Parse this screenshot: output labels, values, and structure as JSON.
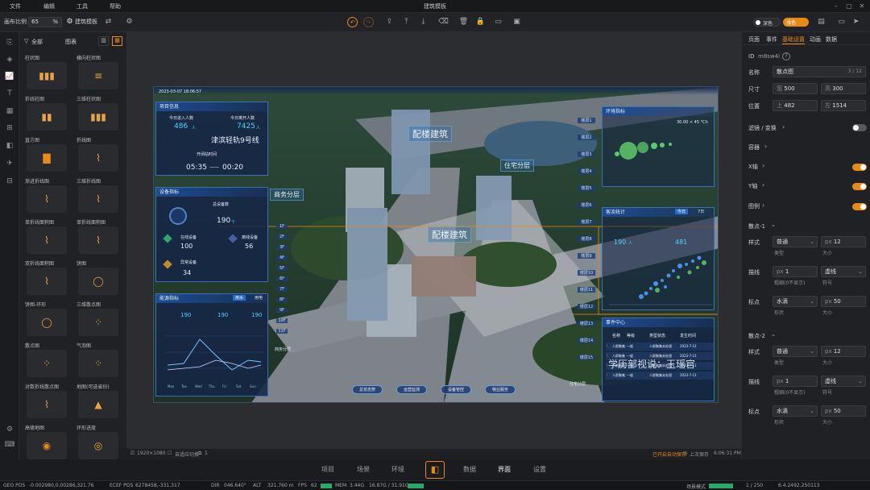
{
  "menu": {
    "file": "文件",
    "edit": "编辑",
    "tools": "工具",
    "help": "帮助",
    "title": "建筑模板"
  },
  "toolbar": {
    "canvas_ratio_label": "画布比例",
    "ratio_value": "65",
    "percent": "%",
    "template_label": "建筑模板",
    "toggle1": "深色",
    "toggle2": "浅色"
  },
  "panel": {
    "all": "全部",
    "charts": "图表",
    "widgets": [
      "柱状图",
      "横向柱状图",
      "折线柱图",
      "三维柱状图",
      "直方图",
      "折线图",
      "渐进折线图",
      "三维折线图",
      "单折线面积图",
      "单折线面积图",
      "双折线面积图",
      "饼图",
      "饼图-环形",
      "三维散点图",
      "散点图",
      "气泡图",
      "对数折线散点图",
      "地图(可选省份)",
      "高德地图",
      "环形进度"
    ]
  },
  "scene": {
    "timestamp": "2023-03-07 18:06:57",
    "proj_title": "项目信息",
    "today_in_label": "今日进入人数",
    "today_in": "486",
    "unit_person": "人",
    "today_out_label": "今日离开人数",
    "today_out": "7425",
    "metro": "津滨轻轨9号线",
    "open_time_label": "开闭站时间",
    "time_open": "05:35",
    "time_dash": "——",
    "time_close": "00:20",
    "device_title": "设备指标",
    "total_dev_label": "总设备数",
    "total_dev": "190",
    "unit_ge": "个",
    "online_label": "在线设备",
    "online": "100",
    "offline_label": "离线设备",
    "offline": "56",
    "abnormal_label": "异常设备",
    "abnormal": "34",
    "energy_title": "能源指标",
    "energy_tab1": "用水",
    "energy_tab2": "用电",
    "e1": "190",
    "e2": "190",
    "e3": "190",
    "e_days": [
      "Mon",
      "Tue",
      "Wed",
      "Thu",
      "Fri",
      "Sat",
      "Sun"
    ],
    "tag_commercial": "商务分层",
    "tag_distribution": "配楼建筑",
    "tag_distribution2": "配楼建筑",
    "tag_residential": "住宅分层",
    "floors": [
      "1F",
      "2F",
      "3F",
      "4F",
      "5F",
      "6F",
      "7F",
      "8F",
      "9F",
      "10F",
      "11F"
    ],
    "floors_right": [
      "楼层1",
      "楼层2",
      "楼层3",
      "楼层4",
      "楼层5",
      "楼层6",
      "楼层7",
      "楼层8",
      "楼层9",
      "楼层10",
      "楼层11",
      "楼层12",
      "楼层13",
      "楼层14",
      "楼层15"
    ],
    "business_label": "商务分层",
    "residential_label": "住宅分层",
    "env_title": "环境指标",
    "passenger_title": "客流统计",
    "today_btn": "今日",
    "range_btn": "7日",
    "today_passenger": "190",
    "unit_person2": "人",
    "yesterday_passenger": "481",
    "bubble_legend": "30.00 < 45 °Ch",
    "event_title": "事件中心",
    "event_headers": [
      "名称",
      "等级",
      "类型状态",
      "发生时间"
    ],
    "event_rows": [
      [
        "人群聚集",
        "一般",
        "人群聚集未处理",
        "2023-7-11"
      ],
      [
        "人群聚集",
        "一般",
        "人群聚集未处理",
        "2023-7-11"
      ],
      [
        "人群聚集",
        "一般",
        "人群聚集未处理",
        "2023-7-11"
      ],
      [
        "人群聚集",
        "一般",
        "人群聚集未处理",
        "2023-7-11"
      ]
    ],
    "nav": [
      "总览态势",
      "运营监测",
      "设备管控",
      "物业服务"
    ],
    "watermark": "学历部视说：玉瑶官"
  },
  "right": {
    "tabs": [
      "页面",
      "事件",
      "基础设置",
      "动画",
      "数据"
    ],
    "id_label": "ID",
    "id_value": "m8sw4i",
    "name_label": "名称",
    "name_value": "散点图",
    "name_count": "3 / 12",
    "size_label": "尺寸",
    "w_label": "宽",
    "w_value": "500",
    "h_label": "高",
    "h_value": "300",
    "pos_label": "位置",
    "top_label": "上",
    "top_value": "482",
    "left_label": "左",
    "left_value": "1514",
    "filter_label": "滤镜 / 变换",
    "container_label": "容器",
    "xaxis_label": "X轴",
    "yaxis_label": "Y轴",
    "legend_label": "图例",
    "series1": "散点-1",
    "series2": "散点-2",
    "style_label": "样式",
    "style_value": "普通",
    "size_prefix": "px",
    "style_size": "12",
    "type_caption": "类型",
    "size_caption": "大小",
    "stroke_label": "描线",
    "stroke_value": "1",
    "stroke_type": "虚线",
    "stroke_caption": "粗细(0不显示)",
    "symbol_caption": "符号",
    "marker_label": "标点",
    "marker_value": "水滴",
    "marker_size": "50",
    "shape_caption": "形状"
  },
  "status": {
    "resolution": "1920×1080",
    "autofit": "自适应切换",
    "layers": "1",
    "autosave": "已开启自动保存",
    "last_saved": "上次保存",
    "save_time": "6:06:31 PM"
  },
  "bottom_tabs": [
    "项目",
    "场景",
    "环境",
    "数据",
    "界面",
    "设置"
  ],
  "footer": {
    "geo_label": "GEO POS",
    "geo": "-0.002980,0.00286,321.76",
    "ecef_label": "ECEF POS",
    "ecef": "6278458,-331.317",
    "dir_label": "DIR",
    "dir": "046.640°",
    "alt_label": "ALT",
    "alt": "321.760 m",
    "fps_label": "FPS",
    "fps": "62",
    "mem_label": "MEM",
    "mem": "3.44G",
    "mem2": "16.87G / 31.91G",
    "mode": "场景模式",
    "frames": "1 / 250",
    "version": "6.4.2492.250113"
  },
  "colors": {
    "accent": "#e88a1a",
    "toggle_on": "#e88a1a",
    "toggle_off": "#55585e",
    "panel_blue": "#1d4b92",
    "cyan": "#4fd3ff"
  }
}
